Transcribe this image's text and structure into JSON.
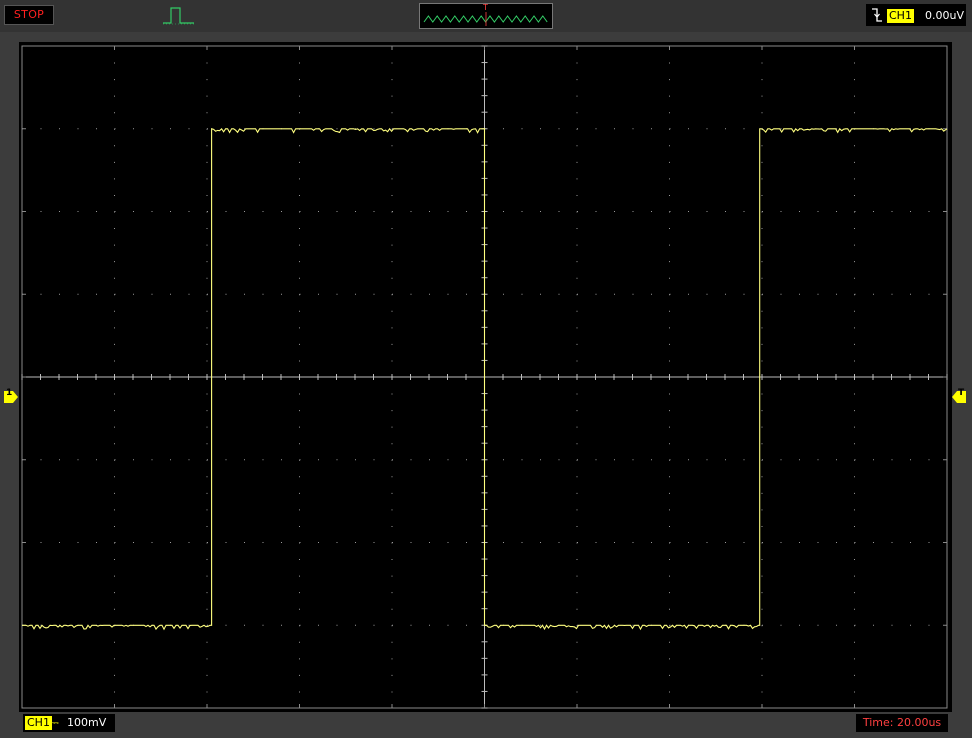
{
  "toolbar": {
    "run_state": "STOP",
    "trigger_marker_letter": "T"
  },
  "channel_status": {
    "channel_label": "CH1",
    "trigger_level": "0.00uV"
  },
  "bottom": {
    "channel_label": "CH1",
    "coupling_symbol": "⎓",
    "volts_per_div": "100mV",
    "timebase": "Time: 20.00us"
  },
  "markers": {
    "channel_marker": "1",
    "trigger_marker": "T"
  },
  "colors": {
    "waveform": "#ffff80",
    "grid_dots": "#9a9a9a",
    "run_state": "#ff2020",
    "channel_badge": "#ffff00",
    "timebase": "#ff4040",
    "mini_window_wave": "#33cc66"
  },
  "icons": {
    "trigger_mode": "pulse-trigger-icon",
    "trigger_edge": "falling-edge-icon"
  },
  "chart_data": {
    "type": "line",
    "title": "",
    "xlabel": "",
    "ylabel": "",
    "x_unit": "us",
    "y_unit": "mV",
    "xlim": [
      -100,
      100
    ],
    "ylim": [
      -400,
      400
    ],
    "grid": true,
    "series": [
      {
        "x": [
          -100,
          -59,
          -59,
          0,
          0,
          59.5,
          59.5,
          100
        ],
        "y": [
          -300,
          -300,
          300,
          300,
          -300,
          -300,
          300,
          300
        ]
      }
    ]
  }
}
